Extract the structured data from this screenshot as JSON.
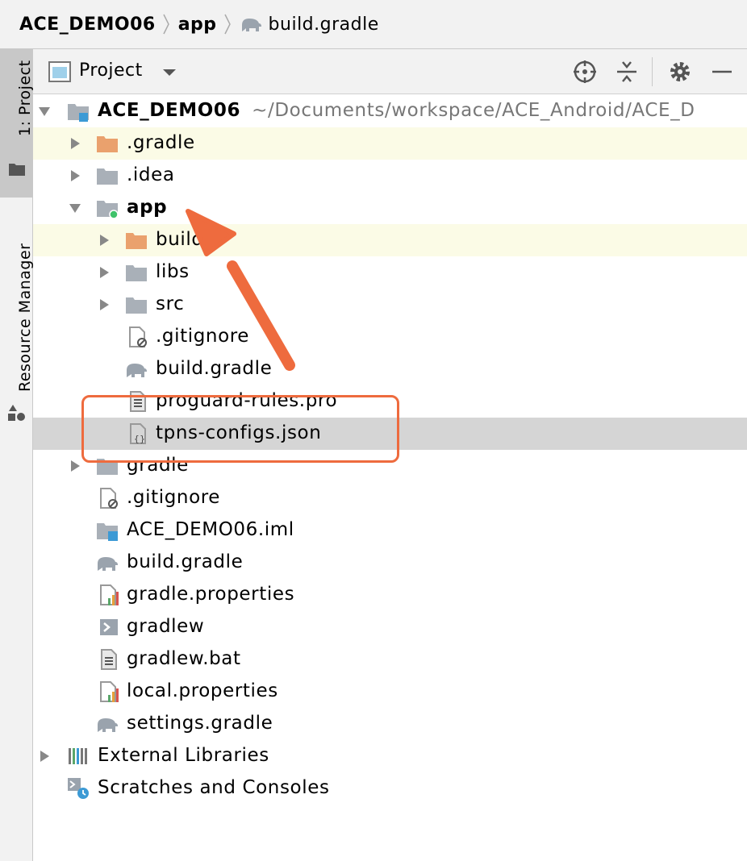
{
  "breadcrumb": {
    "items": [
      "ACE_DEMO06",
      "app",
      "build.gradle"
    ]
  },
  "sidebar": {
    "tabs": [
      {
        "label": "1: Project",
        "icon": "folder-icon"
      },
      {
        "label": "Resource Manager",
        "icon": "resource-manager-icon"
      }
    ]
  },
  "panel": {
    "title": "Project",
    "actions": [
      "locate-icon",
      "collapse-all-icon",
      "gear-icon",
      "hide-icon"
    ]
  },
  "tree": {
    "root_label": "ACE_DEMO06",
    "root_path": "~/Documents/workspace/ACE_Android/ACE_D",
    "rows": [
      {
        "label": ".gradle"
      },
      {
        "label": ".idea"
      },
      {
        "label": "app"
      },
      {
        "label": "build"
      },
      {
        "label": "libs"
      },
      {
        "label": "src"
      },
      {
        "label": ".gitignore"
      },
      {
        "label": "build.gradle"
      },
      {
        "label": "proguard-rules.pro"
      },
      {
        "label": "tpns-configs.json"
      },
      {
        "label": "gradle"
      },
      {
        "label": ".gitignore"
      },
      {
        "label": "ACE_DEMO06.iml"
      },
      {
        "label": "build.gradle"
      },
      {
        "label": "gradle.properties"
      },
      {
        "label": "gradlew"
      },
      {
        "label": "gradlew.bat"
      },
      {
        "label": "local.properties"
      },
      {
        "label": "settings.gradle"
      },
      {
        "label": "External Libraries"
      },
      {
        "label": "Scratches and Consoles"
      }
    ]
  },
  "colors": {
    "annotation": "#ee6b3e",
    "folder_excluded": "#eaa16d",
    "folder": "#a9b0b8",
    "selected_row": "#d5d5d5",
    "highlight_row": "#fbfbe6"
  }
}
